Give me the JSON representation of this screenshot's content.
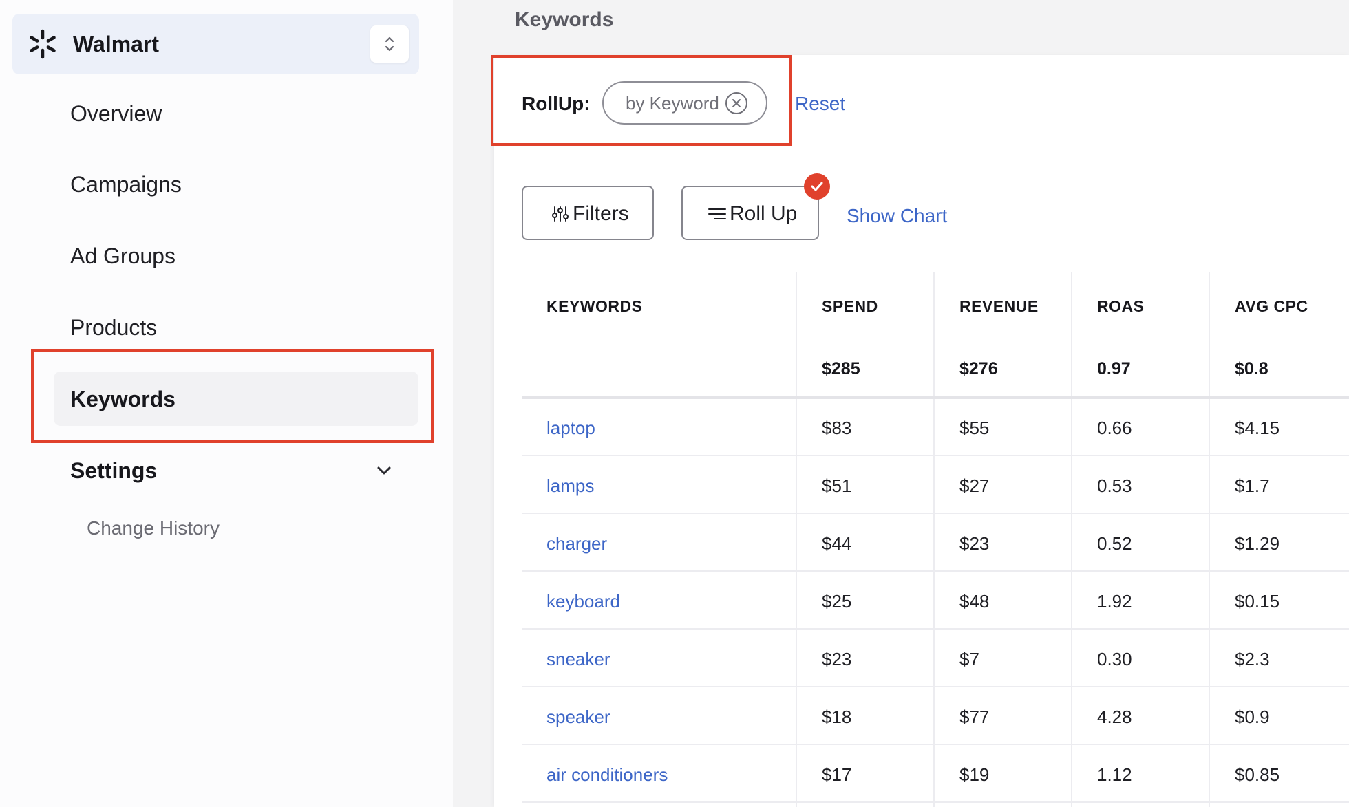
{
  "sidebar": {
    "brand": {
      "name": "Walmart",
      "logo_icon": "walmart-spark-icon",
      "switcher_icon": "chevron-up-down-icon"
    },
    "items": [
      {
        "label": "Overview"
      },
      {
        "label": "Campaigns"
      },
      {
        "label": "Ad Groups"
      },
      {
        "label": "Products"
      },
      {
        "label": "Keywords",
        "active": true
      }
    ],
    "settings": {
      "label": "Settings",
      "icon": "chevron-down-icon",
      "children": [
        {
          "label": "Change History"
        }
      ]
    }
  },
  "main": {
    "title": "Keywords",
    "rollup": {
      "label": "RollUp:",
      "chip": "by Keyword",
      "chip_icon": "close-circle-icon",
      "reset": "Reset"
    },
    "toolbar": {
      "filters": {
        "label": "Filters",
        "icon": "sliders-icon"
      },
      "rollup": {
        "label": "Roll Up",
        "icon": "lines-icon",
        "badge_icon": "check-icon"
      },
      "show_chart": "Show Chart"
    },
    "table": {
      "columns": [
        "KEYWORDS",
        "SPEND",
        "REVENUE",
        "ROAS",
        "AVG CPC"
      ],
      "totals": [
        "",
        "$285",
        "$276",
        "0.97",
        "$0.8"
      ],
      "rows": [
        [
          "laptop",
          "$83",
          "$55",
          "0.66",
          "$4.15"
        ],
        [
          "lamps",
          "$51",
          "$27",
          "0.53",
          "$1.7"
        ],
        [
          "charger",
          "$44",
          "$23",
          "0.52",
          "$1.29"
        ],
        [
          "keyboard",
          "$25",
          "$48",
          "1.92",
          "$0.15"
        ],
        [
          "sneaker",
          "$23",
          "$7",
          "0.30",
          "$2.3"
        ],
        [
          "speaker",
          "$18",
          "$77",
          "4.28",
          "$0.9"
        ],
        [
          "air conditioners",
          "$17",
          "$19",
          "1.12",
          "$0.85"
        ]
      ]
    }
  },
  "colors": {
    "accent": "#3d66c7",
    "highlight": "#e0412c",
    "brand_bg": "#ecf0f9"
  }
}
